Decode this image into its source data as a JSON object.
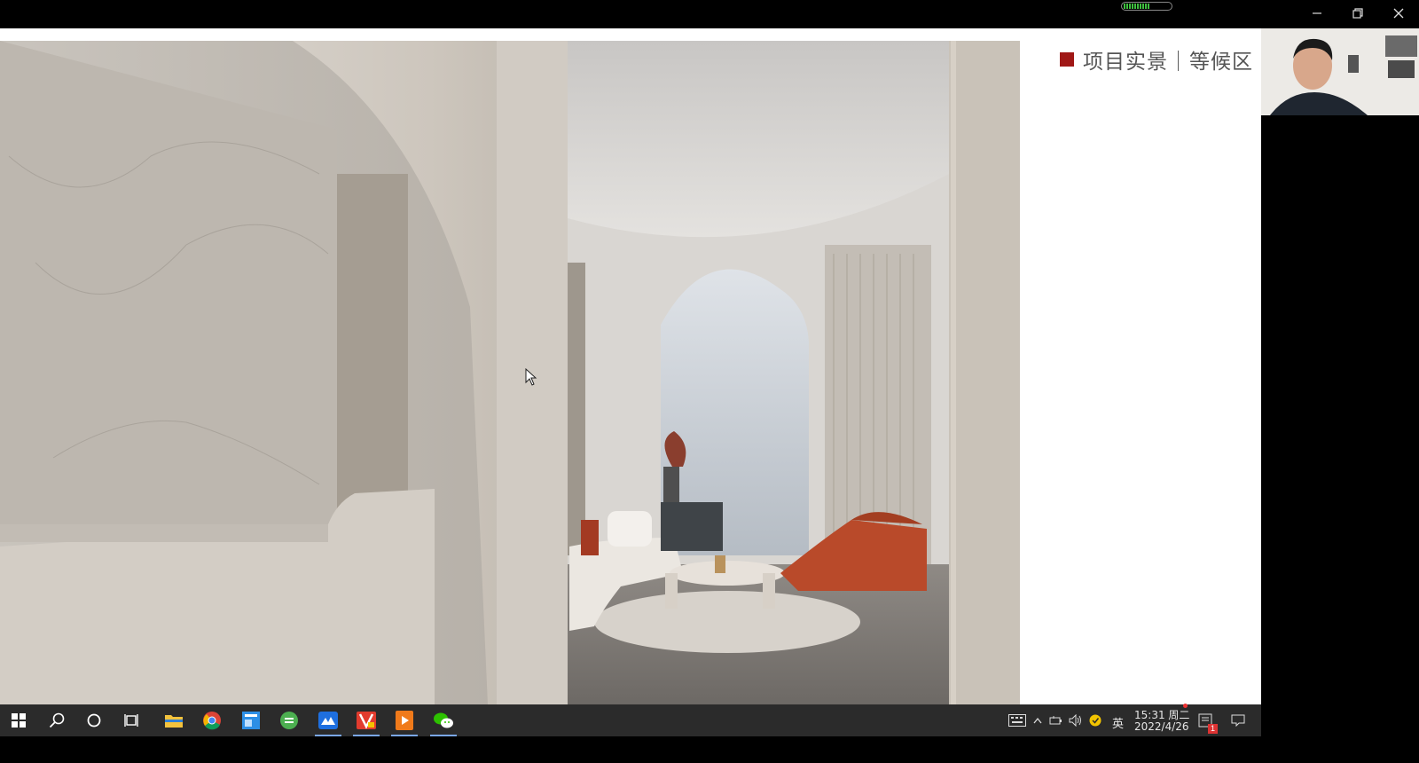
{
  "slide": {
    "title": "项目实景｜等候区"
  },
  "webcam": {
    "label": "presenter-webcam"
  },
  "taskbar": {
    "apps": [
      {
        "icon": "windows-start-icon",
        "active": false
      },
      {
        "icon": "search-icon",
        "active": false
      },
      {
        "icon": "cortana-circle-icon",
        "active": false
      },
      {
        "icon": "task-view-icon",
        "active": false
      },
      {
        "icon": "file-explorer-icon",
        "active": false
      },
      {
        "icon": "chrome-icon",
        "active": false
      },
      {
        "icon": "blue-app-icon",
        "active": false
      },
      {
        "icon": "green-circle-app-icon",
        "active": false
      },
      {
        "icon": "meeting-app-icon",
        "active": true
      },
      {
        "icon": "vector-app-icon",
        "active": true
      },
      {
        "icon": "media-player-icon",
        "active": true
      },
      {
        "icon": "wechat-icon",
        "active": true
      }
    ],
    "tray": {
      "ime": "英",
      "time": "15:31 周二",
      "date": "2022/4/26",
      "notification_count": "1"
    }
  },
  "colors": {
    "accent_red": "#a01816",
    "taskbar_bg": "#2b2b2b",
    "active_underline": "#7aa7e8"
  }
}
